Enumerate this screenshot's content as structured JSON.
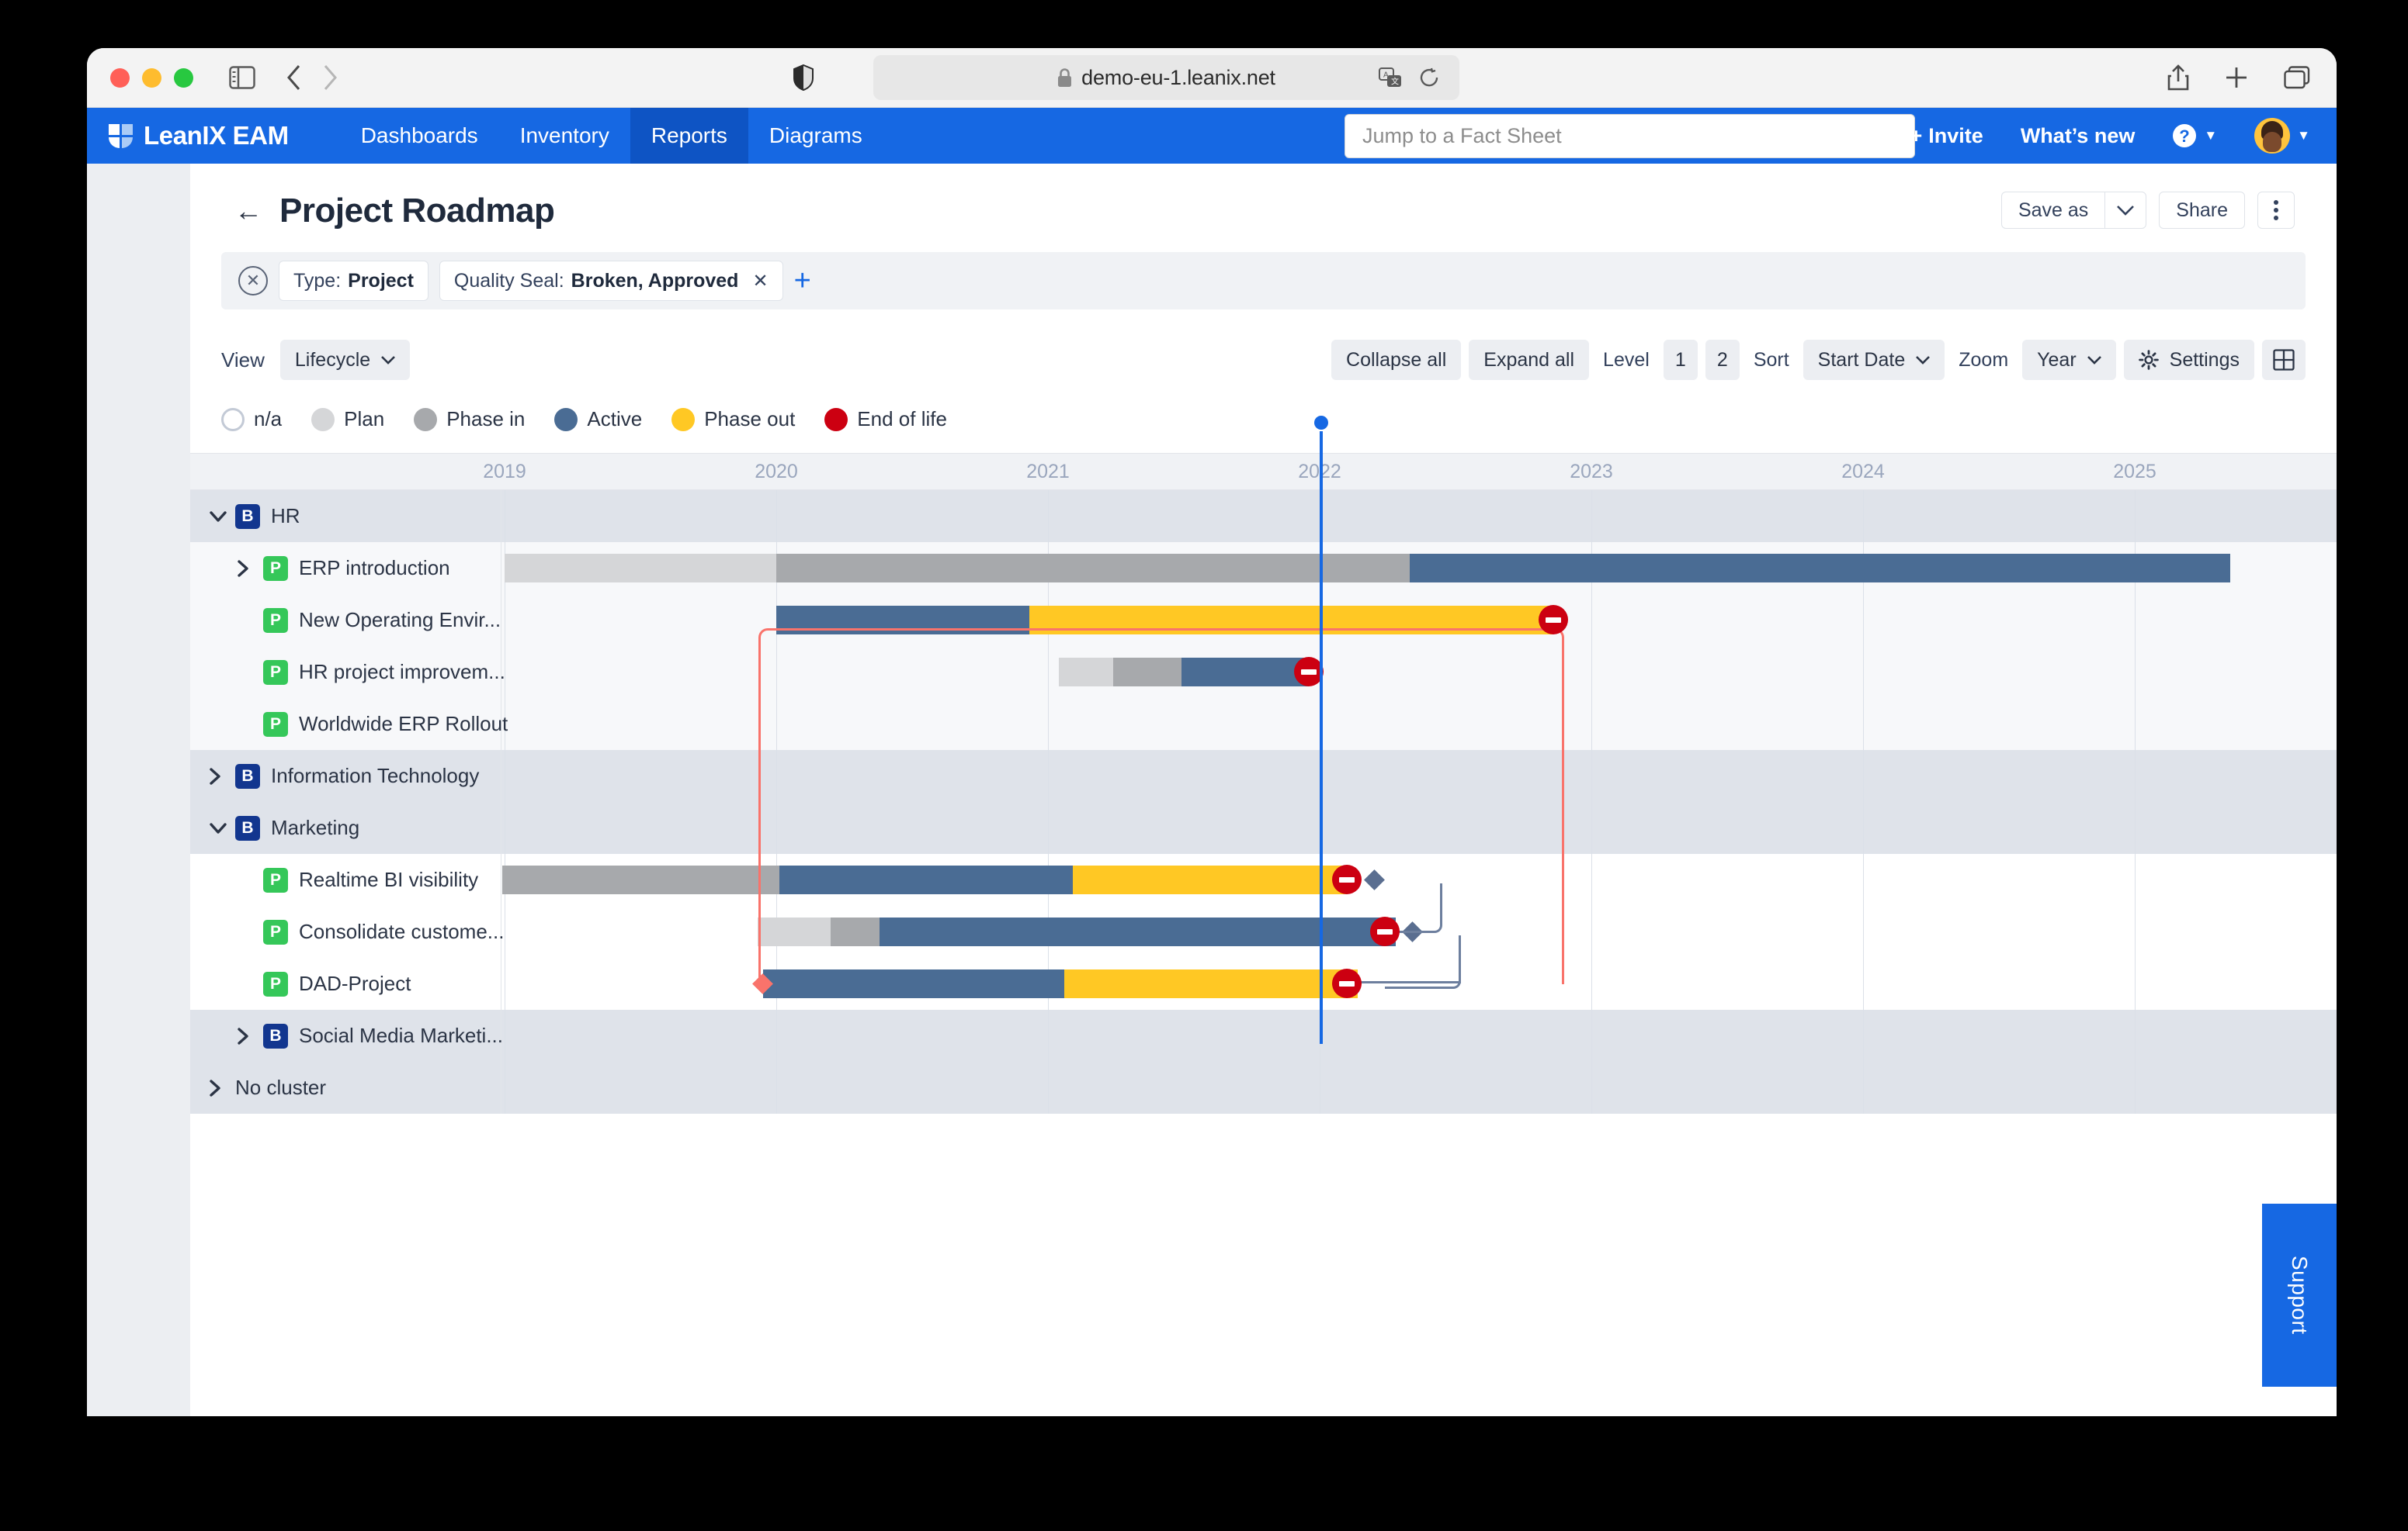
{
  "browser": {
    "url": "demo-eu-1.leanix.net",
    "lock_icon": "lock-icon",
    "sidebar_icon": "sidebar-toggle-icon",
    "back_icon": "back-chevron-icon",
    "forward_icon": "forward-chevron-icon",
    "shield_icon": "privacy-shield-icon",
    "translate_icon": "translate-icon",
    "reload_icon": "reload-icon",
    "share_icon": "share-icon",
    "newtab_icon": "new-tab-icon",
    "tabs_icon": "show-tabs-icon"
  },
  "navbar": {
    "brand": "LeanIX EAM",
    "items": [
      {
        "label": "Dashboards",
        "active": false
      },
      {
        "label": "Inventory",
        "active": false
      },
      {
        "label": "Reports",
        "active": true
      },
      {
        "label": "Diagrams",
        "active": false
      }
    ],
    "search_placeholder": "Jump to a Fact Sheet",
    "invite_label": "Invite",
    "whats_new_label": "What’s new",
    "help_icon": "help-question-icon",
    "avatar_icon": "user-avatar",
    "accent": "#1668e3",
    "active_tab_bg": "#0e54c4"
  },
  "header": {
    "back_icon": "back-arrow-icon",
    "title": "Project Roadmap",
    "save_as_label": "Save as",
    "save_as_caret": "chevron-down-icon",
    "share_label": "Share",
    "more_icon": "more-vertical-icon"
  },
  "filters": {
    "clear_icon": "clear-filters-icon",
    "chips": [
      {
        "label": "Type:",
        "value": "Project",
        "removable": false
      },
      {
        "label": "Quality Seal:",
        "value": "Broken, Approved",
        "removable": true,
        "remove_icon": "close-x-icon"
      }
    ],
    "add_icon": "add-filter-plus-icon"
  },
  "toolbar": {
    "view_label": "View",
    "view_value": "Lifecycle",
    "collapse_all": "Collapse all",
    "expand_all": "Expand all",
    "level_label": "Level",
    "levels": [
      "1",
      "2"
    ],
    "sort_label": "Sort",
    "sort_value": "Start Date",
    "zoom_label": "Zoom",
    "zoom_value": "Year",
    "settings_label": "Settings",
    "settings_icon": "gear-icon",
    "grid_icon": "grid-layout-icon",
    "caret_icon": "chevron-down-icon"
  },
  "legend": [
    {
      "label": "n/a",
      "color": "#ffffff",
      "outline": true
    },
    {
      "label": "Plan",
      "color": "#d5d6d8",
      "outline": false
    },
    {
      "label": "Phase in",
      "color": "#a7a9ac",
      "outline": false
    },
    {
      "label": "Active",
      "color": "#4a6c94",
      "outline": false
    },
    {
      "label": "Phase out",
      "color": "#ffc824",
      "outline": false
    },
    {
      "label": "End of life",
      "color": "#cc0011",
      "outline": false
    }
  ],
  "chart_data": {
    "type": "bar",
    "title": "Project Roadmap",
    "xlabel": "",
    "ylabel": "",
    "axis_years": [
      "2019",
      "2020",
      "2021",
      "2022",
      "2023",
      "2024",
      "2025"
    ],
    "today_marker": "2022",
    "rows": [
      {
        "name": "HR",
        "kind": "group",
        "badge": "B",
        "expanded": true,
        "toggle": "chevron-down-icon",
        "segments": []
      },
      {
        "name": "ERP introduction",
        "kind": "leaf",
        "badge": "P",
        "expanded": false,
        "toggle": "chevron-right-icon",
        "segments": [
          {
            "phase": "Plan",
            "start": 2019.0,
            "end": 2020.0
          },
          {
            "phase": "Phase in",
            "start": 2020.0,
            "end": 2022.33
          },
          {
            "phase": "Active",
            "start": 2022.33,
            "end": 2025.35
          }
        ],
        "end_of_life": null
      },
      {
        "name": "New Operating Envir...",
        "kind": "leaf",
        "badge": "P",
        "segments": [
          {
            "phase": "Active",
            "start": 2020.0,
            "end": 2020.93
          },
          {
            "phase": "Phase out",
            "start": 2020.93,
            "end": 2022.86
          }
        ],
        "end_of_life": 2022.86
      },
      {
        "name": "HR project improvem...",
        "kind": "leaf",
        "badge": "P",
        "segments": [
          {
            "phase": "Plan",
            "start": 2021.04,
            "end": 2021.24
          },
          {
            "phase": "Phase in",
            "start": 2021.24,
            "end": 2021.49
          },
          {
            "phase": "Active",
            "start": 2021.49,
            "end": 2021.96
          }
        ],
        "end_of_life": 2021.96
      },
      {
        "name": "Worldwide ERP Rollout",
        "kind": "leaf",
        "badge": "P",
        "segments": [],
        "end_of_life": null
      },
      {
        "name": "Information Technology",
        "kind": "group",
        "badge": "B",
        "expanded": false,
        "toggle": "chevron-right-icon",
        "segments": []
      },
      {
        "name": "Marketing",
        "kind": "group",
        "badge": "B",
        "expanded": true,
        "toggle": "chevron-down-icon",
        "segments": []
      },
      {
        "name": "Realtime BI visibility",
        "kind": "leaf",
        "badge": "P",
        "segments": [
          {
            "phase": "Phase in",
            "start": 2018.99,
            "end": 2020.01
          },
          {
            "phase": "Active",
            "start": 2020.01,
            "end": 2021.09
          },
          {
            "phase": "Phase out",
            "start": 2021.09,
            "end": 2022.1
          }
        ],
        "end_of_life": 2022.1,
        "milestone": 2022.2
      },
      {
        "name": "Consolidate custome...",
        "kind": "leaf",
        "badge": "P",
        "segments": [
          {
            "phase": "Plan",
            "start": 2019.93,
            "end": 2020.2
          },
          {
            "phase": "Phase in",
            "start": 2020.2,
            "end": 2020.38
          },
          {
            "phase": "Active",
            "start": 2020.38,
            "end": 2022.28
          }
        ],
        "end_of_life": 2022.24,
        "milestone": 2022.34
      },
      {
        "name": "DAD-Project",
        "kind": "leaf",
        "badge": "P",
        "segments": [
          {
            "phase": "Active",
            "start": 2019.95,
            "end": 2021.06
          },
          {
            "phase": "Phase out",
            "start": 2021.06,
            "end": 2022.14
          }
        ],
        "end_of_life": 2022.1,
        "milestone_red": 2019.95
      },
      {
        "name": "Social Media Marketi...",
        "kind": "group",
        "badge": "B",
        "expanded": false,
        "toggle": "chevron-right-icon",
        "segments": []
      },
      {
        "name": "No cluster",
        "kind": "group",
        "badge": null,
        "expanded": false,
        "toggle": "chevron-right-icon",
        "segments": []
      }
    ]
  },
  "support": {
    "label": "Support"
  }
}
